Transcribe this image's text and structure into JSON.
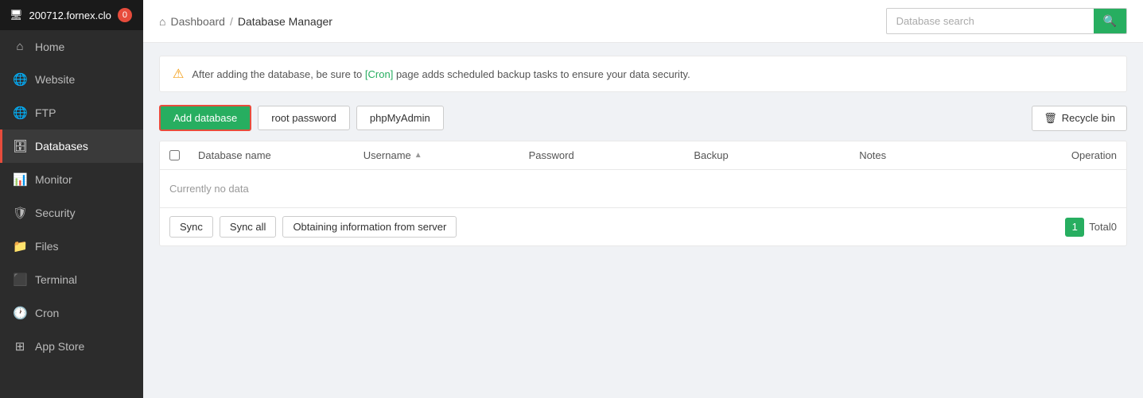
{
  "sidebar": {
    "account": "200712.fornex.clo",
    "badge": "0",
    "items": [
      {
        "id": "home",
        "label": "Home",
        "icon": "⌂",
        "active": false
      },
      {
        "id": "website",
        "label": "Website",
        "icon": "🌐",
        "active": false
      },
      {
        "id": "ftp",
        "label": "FTP",
        "icon": "🌐",
        "active": false
      },
      {
        "id": "databases",
        "label": "Databases",
        "icon": "🗄",
        "active": true
      },
      {
        "id": "monitor",
        "label": "Monitor",
        "icon": "📊",
        "active": false
      },
      {
        "id": "security",
        "label": "Security",
        "icon": "🛡",
        "active": false
      },
      {
        "id": "files",
        "label": "Files",
        "icon": "📁",
        "active": false
      },
      {
        "id": "terminal",
        "label": "Terminal",
        "icon": "⬛",
        "active": false
      },
      {
        "id": "cron",
        "label": "Cron",
        "icon": "🕐",
        "active": false
      },
      {
        "id": "appstore",
        "label": "App Store",
        "icon": "⊞",
        "active": false
      }
    ]
  },
  "header": {
    "breadcrumb_home": "Dashboard",
    "breadcrumb_separator": "/",
    "breadcrumb_current": "Database Manager",
    "search_placeholder": "Database search"
  },
  "notice": {
    "text_before": "After adding the database, be sure to",
    "link_text": "[Cron]",
    "text_after": "page adds scheduled backup tasks to ensure your data security."
  },
  "toolbar": {
    "add_database": "Add database",
    "root_password": "root password",
    "phpmyadmin": "phpMyAdmin",
    "recycle_bin": "Recycle bin"
  },
  "table": {
    "columns": [
      "Database name",
      "Username",
      "Password",
      "Backup",
      "Notes",
      "Operation"
    ],
    "no_data": "Currently no data"
  },
  "footer": {
    "sync": "Sync",
    "sync_all": "Sync all",
    "obtaining": "Obtaining information from server",
    "page": "1",
    "total": "Total0"
  }
}
